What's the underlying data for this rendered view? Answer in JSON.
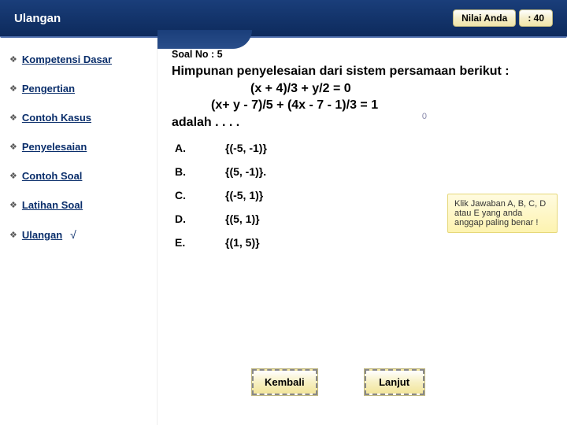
{
  "header": {
    "title": "Ulangan",
    "score_label": "Nilai Anda",
    "score_value": ": 40"
  },
  "sidebar": {
    "items": [
      {
        "label": "Kompetensi Dasar",
        "checked": false
      },
      {
        "label": "Pengertian",
        "checked": false
      },
      {
        "label": "Contoh Kasus",
        "checked": false
      },
      {
        "label": "Penyelesaian",
        "checked": false
      },
      {
        "label": "Contoh Soal",
        "checked": false
      },
      {
        "label": "Latihan Soal",
        "checked": false
      },
      {
        "label": "Ulangan",
        "checked": true
      }
    ]
  },
  "content": {
    "soal_no": "Soal No : 5",
    "question_l1": "Himpunan penyelesaian dari sistem persamaan berikut :",
    "question_l2": "(x + 4)/3 + y/2 = 0",
    "question_l3": "(x+ y - 7)/5 + (4x - 7 - 1)/3 = 1",
    "question_l4": "adalah . . . .",
    "options": [
      {
        "letter": "A.",
        "text": "{(-5, -1)}"
      },
      {
        "letter": "B.",
        "text": "{(5, -1)}."
      },
      {
        "letter": "C.",
        "text": "{(-5, 1)}"
      },
      {
        "letter": "D.",
        "text": "{(5, 1)}"
      },
      {
        "letter": "E.",
        "text": "{(1, 5)}"
      }
    ],
    "hint": "Klik Jawaban A, B, C, D atau E yang anda anggap paling benar !",
    "badge": "0"
  },
  "buttons": {
    "back": "Kembali",
    "next": "Lanjut"
  }
}
